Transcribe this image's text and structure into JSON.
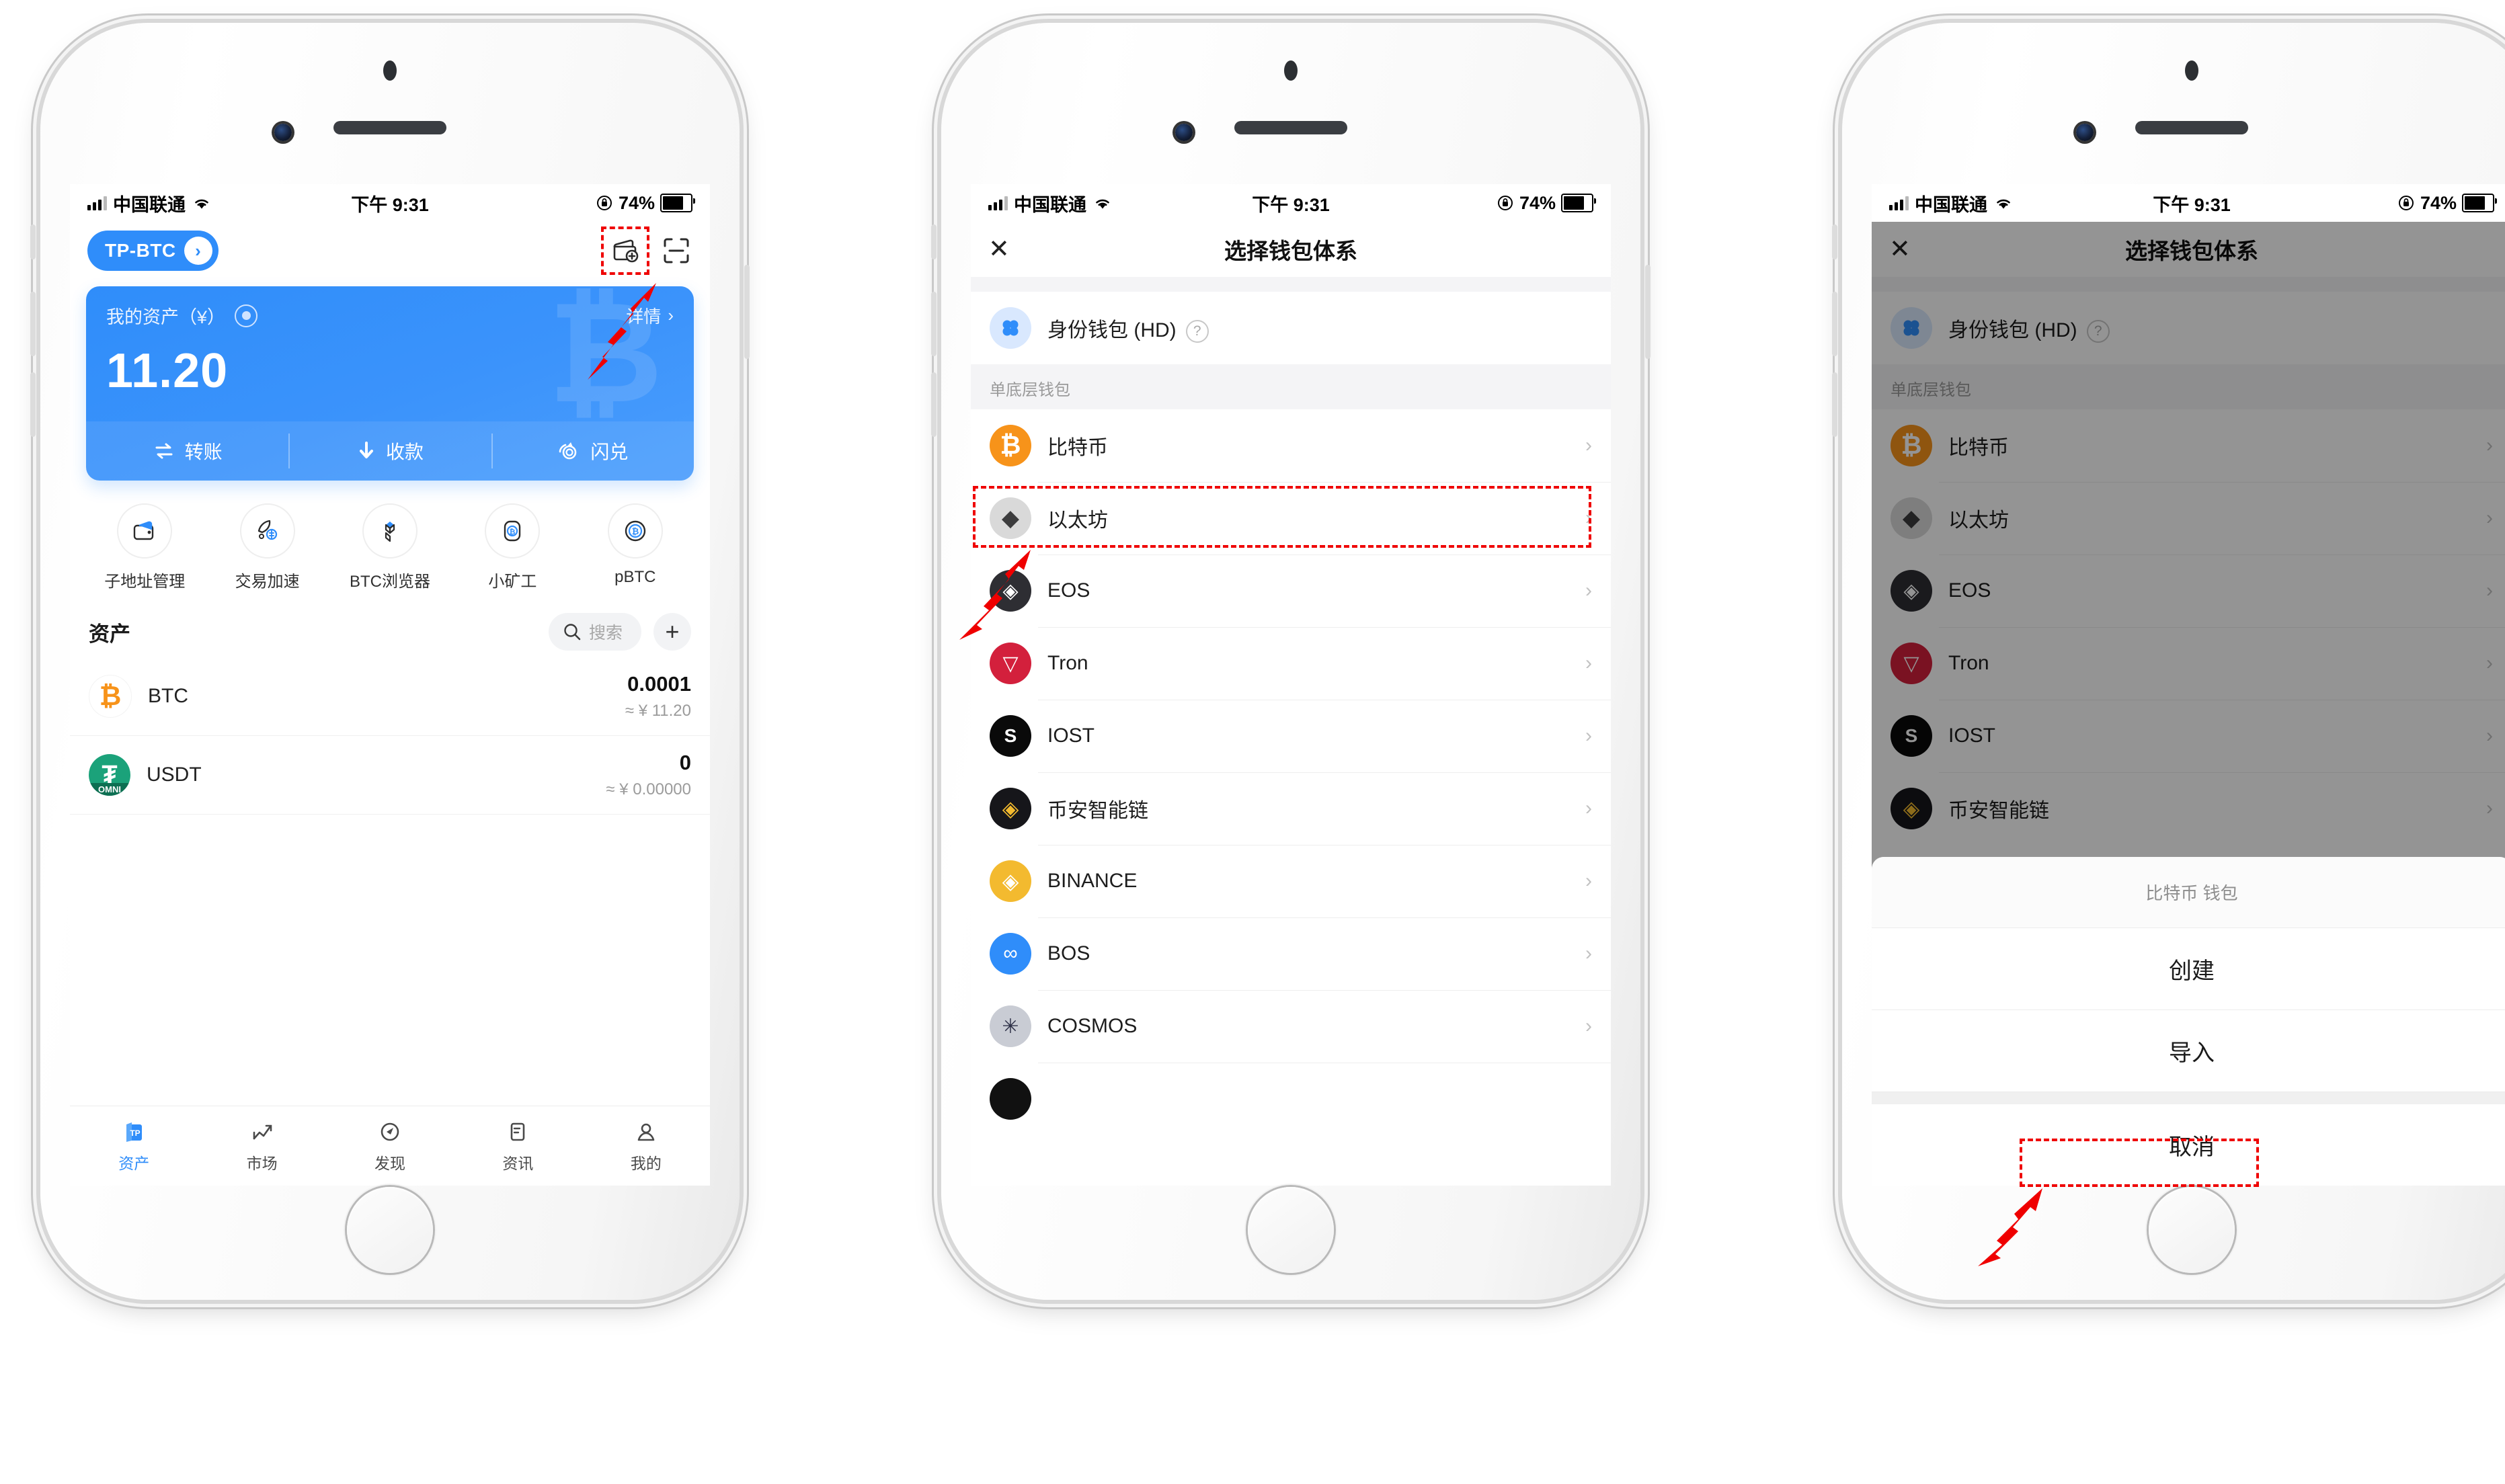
{
  "status_bar": {
    "carrier": "中国联通",
    "time": "下午 9:31",
    "battery": "74%"
  },
  "phone1": {
    "wallet_chip": "TP-BTC",
    "icons": {
      "add_wallet": "add-wallet-icon",
      "scan": "scan-icon"
    },
    "card": {
      "label": "我的资产（¥）",
      "detail": "详情",
      "amount": "11.20",
      "watermark": "₿",
      "actions": [
        {
          "label": "转账",
          "icon": "transfer-icon"
        },
        {
          "label": "收款",
          "icon": "receive-icon"
        },
        {
          "label": "闪兑",
          "icon": "flash-swap-icon"
        }
      ]
    },
    "features": [
      {
        "label": "子地址管理",
        "icon": "wallet-card-icon"
      },
      {
        "label": "交易加速",
        "icon": "rocket-icon"
      },
      {
        "label": "BTC浏览器",
        "icon": "blocks-icon"
      },
      {
        "label": "小矿工",
        "icon": "miner-icon"
      },
      {
        "label": "pBTC",
        "icon": "pbtc-icon"
      }
    ],
    "assets_section": {
      "title": "资产",
      "search_placeholder": "搜索",
      "add_label": "+"
    },
    "assets": [
      {
        "symbol": "BTC",
        "glyph": "₿",
        "amount": "0.0001",
        "fiat": "≈ ¥ 11.20",
        "color": "#f7931a",
        "bg": "#ffffff"
      },
      {
        "symbol": "USDT",
        "glyph": "₮",
        "amount": "0",
        "fiat": "≈ ¥ 0.00000",
        "color": "#ffffff",
        "bg": "#1ba27a",
        "badge": "OMNI"
      }
    ],
    "tabs": [
      {
        "label": "资产",
        "icon": "tp-wallet-icon",
        "active": true
      },
      {
        "label": "市场",
        "icon": "chart-icon",
        "active": false
      },
      {
        "label": "发现",
        "icon": "compass-icon",
        "active": false
      },
      {
        "label": "资讯",
        "icon": "news-icon",
        "active": false
      },
      {
        "label": "我的",
        "icon": "person-icon",
        "active": false
      }
    ]
  },
  "phone2": {
    "nav": {
      "close": "✕",
      "title": "选择钱包体系"
    },
    "hd_wallet": {
      "label": "身份钱包 (HD)",
      "help": "?",
      "icon": "four-dots-icon"
    },
    "section_label": "单底层钱包",
    "chains": [
      {
        "label": "比特币",
        "glyph": "₿",
        "bg": "#f7931a",
        "fg": "#ffffff",
        "highlight": true
      },
      {
        "label": "以太坊",
        "glyph": "◆",
        "bg": "#d9d9d9",
        "fg": "#3c3c3d",
        "highlight": false
      },
      {
        "label": "EOS",
        "glyph": "◈",
        "bg": "#2e2e33",
        "fg": "#ffffff",
        "highlight": false
      },
      {
        "label": "Tron",
        "glyph": "▽",
        "bg": "#d3203c",
        "fg": "#ffffff",
        "highlight": false
      },
      {
        "label": "IOST",
        "glyph": "S",
        "bg": "#0a0a0a",
        "fg": "#ffffff",
        "highlight": false
      },
      {
        "label": "币安智能链",
        "glyph": "◈",
        "bg": "#16161a",
        "fg": "#f3ba2f",
        "highlight": false
      },
      {
        "label": "BINANCE",
        "glyph": "◈",
        "bg": "#f3ba2f",
        "fg": "#ffffff",
        "highlight": false
      },
      {
        "label": "BOS",
        "glyph": "∞",
        "bg": "#2f8dfa",
        "fg": "#ffffff",
        "highlight": false
      },
      {
        "label": "COSMOS",
        "glyph": "✳",
        "bg": "#c9ccd4",
        "fg": "#2e3148",
        "highlight": false
      }
    ],
    "chevron": "›"
  },
  "phone3": {
    "nav": {
      "close": "✕",
      "title": "选择钱包体系"
    },
    "hd_wallet": {
      "label": "身份钱包 (HD)",
      "help": "?",
      "icon": "four-dots-icon"
    },
    "section_label": "单底层钱包",
    "chains": [
      {
        "label": "比特币",
        "glyph": "₿",
        "bg": "#f7931a",
        "fg": "#ffffff"
      },
      {
        "label": "以太坊",
        "glyph": "◆",
        "bg": "#d9d9d9",
        "fg": "#3c3c3d"
      },
      {
        "label": "EOS",
        "glyph": "◈",
        "bg": "#2e2e33",
        "fg": "#ffffff"
      },
      {
        "label": "Tron",
        "glyph": "▽",
        "bg": "#d3203c",
        "fg": "#ffffff"
      },
      {
        "label": "IOST",
        "glyph": "S",
        "bg": "#0a0a0a",
        "fg": "#ffffff"
      },
      {
        "label": "币安智能链",
        "glyph": "◈",
        "bg": "#16161a",
        "fg": "#f3ba2f"
      }
    ],
    "chevron": "›",
    "action_sheet": {
      "title": "比特币 钱包",
      "create": "创建",
      "import": "导入",
      "cancel": "取消"
    }
  },
  "annotations": {
    "accent": "#ef0000"
  }
}
